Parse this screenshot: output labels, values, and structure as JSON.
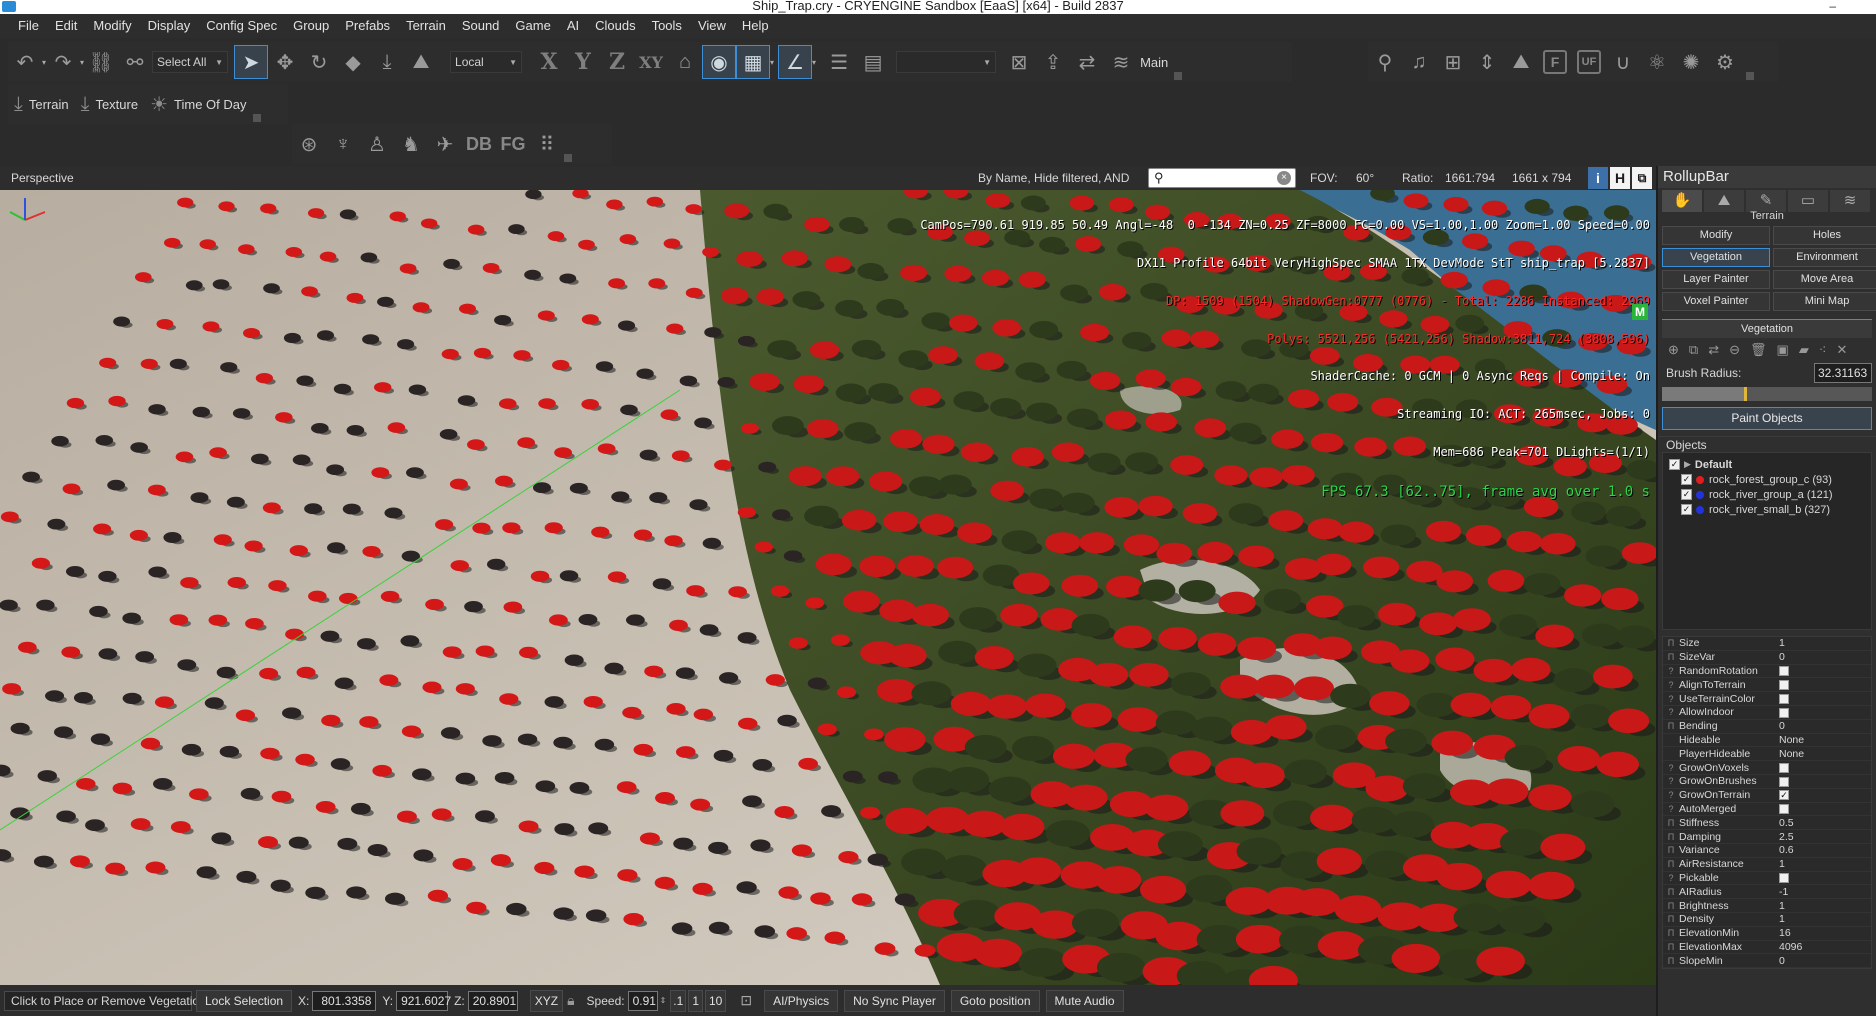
{
  "titlebar": {
    "title": "Ship_Trap.cry - CRYENGINE Sandbox [EaaS] [x64] - Build 2837"
  },
  "menu": [
    "File",
    "Edit",
    "Modify",
    "Display",
    "Config Spec",
    "Group",
    "Prefabs",
    "Terrain",
    "Sound",
    "Game",
    "AI",
    "Clouds",
    "Tools",
    "View",
    "Help"
  ],
  "toolbar": {
    "select_all": "Select All",
    "ref_coord": "Local",
    "axis_x": "X",
    "axis_y": "Y",
    "axis_z": "Z",
    "axis_xy": "XY",
    "layer_label": "Main",
    "letter_f": "F",
    "letter_uf": "UF",
    "terrain_label": "Terrain",
    "texture_label": "Texture",
    "tod_label": "Time Of Day",
    "db_label": "DB",
    "fg_label": "FG"
  },
  "viewport": {
    "title": "Perspective",
    "filter_text": "By Name, Hide filtered, AND",
    "search_value": "",
    "fov_label": "FOV:",
    "fov_value": "60°",
    "ratio_label": "Ratio:",
    "ratio_value": "1661:794",
    "resolution": "1661 x 794",
    "toggle_i": "i",
    "toggle_h": "H",
    "stats": [
      {
        "text": "CamPos=790.61 919.85 50.49 Angl=-48  0 -134 ZN=0.25 ZF=8000 FC=0.00 VS=1.00,1.00 Zoom=1.00 Speed=0.00",
        "color": "#ffffff"
      },
      {
        "text": "DX11 Profile 64bit VeryHighSpec SMAA 1TX DevMode StT ship_trap [5.2837]",
        "color": "#ffffff"
      },
      {
        "text": "DP: 1509 (1504) ShadowGen:0777 (0776) - Total: 2286 Instanced: 2969",
        "color": "#ff2a2a"
      },
      {
        "text": "Polys: 5521,256 (5421,256) Shadow:3811,724 (3808,596)",
        "color": "#ff2a2a"
      },
      {
        "text": "ShaderCache: 0 GCM | 0 Async Reqs | Compile: On",
        "color": "#ffffff"
      },
      {
        "text": "Streaming IO: ACT: 265msec, Jobs: 0",
        "color": "#ffffff"
      },
      {
        "text": "Mem=686 Peak=701 DLights=(1/1)",
        "color": "#ffffff"
      }
    ],
    "fps": "FPS 67.3 [62..75], frame avg over 1.0 s",
    "m_badge": "M"
  },
  "statusbar": {
    "hint": "Click to Place or Remove Vegetation",
    "lock_selection": "Lock Selection",
    "x_label": "X:",
    "x_value": "801.3358",
    "y_label": "Y:",
    "y_value": "921.6027",
    "z_label": "Z:",
    "z_value": "20.8901",
    "xyz_btn": "XYZ",
    "speed_label": "Speed:",
    "speed_value": "0.91",
    "speed_01": ".1",
    "speed_1": "1",
    "speed_10": "10",
    "ai_physics": "AI/Physics",
    "no_sync": "No Sync Player",
    "goto_position": "Goto position",
    "mute_audio": "Mute Audio"
  },
  "rollup": {
    "title": "RollupBar",
    "section_title": "Terrain",
    "buttons": [
      "Modify",
      "Holes",
      "Vegetation",
      "Environment",
      "Layer Painter",
      "Move Area",
      "Voxel Painter",
      "Mini Map"
    ],
    "vegetation_header": "Vegetation",
    "brush_radius_label": "Brush Radius:",
    "brush_radius_value": "32.31163",
    "brush_fraction": 0.39,
    "paint_objects": "Paint Objects",
    "objects_label": "Objects",
    "tree_group": "Default",
    "tree_items": [
      {
        "label": "rock_forest_group_c (93)",
        "color": "#e01e1e"
      },
      {
        "label": "rock_river_group_a (121)",
        "color": "#2233dd"
      },
      {
        "label": "rock_river_small_b (327)",
        "color": "#2233dd"
      }
    ],
    "properties": [
      {
        "icon": "Π",
        "name": "Size",
        "value": "1"
      },
      {
        "icon": "Π",
        "name": "SizeVar",
        "value": "0"
      },
      {
        "icon": "?",
        "name": "RandomRotation",
        "value": "",
        "check": false
      },
      {
        "icon": "?",
        "name": "AlignToTerrain",
        "value": "",
        "check": false
      },
      {
        "icon": "?",
        "name": "UseTerrainColor",
        "value": "",
        "check": false
      },
      {
        "icon": "?",
        "name": "AllowIndoor",
        "value": "",
        "check": false
      },
      {
        "icon": "Π",
        "name": "Bending",
        "value": "0"
      },
      {
        "icon": "",
        "name": "Hideable",
        "value": "None"
      },
      {
        "icon": "",
        "name": "PlayerHideable",
        "value": "None"
      },
      {
        "icon": "?",
        "name": "GrowOnVoxels",
        "value": "",
        "check": false
      },
      {
        "icon": "?",
        "name": "GrowOnBrushes",
        "value": "",
        "check": false
      },
      {
        "icon": "?",
        "name": "GrowOnTerrain",
        "value": "",
        "check": true
      },
      {
        "icon": "?",
        "name": "AutoMerged",
        "value": "",
        "check": false
      },
      {
        "icon": "Π",
        "name": "Stiffness",
        "value": "0.5"
      },
      {
        "icon": "Π",
        "name": "Damping",
        "value": "2.5"
      },
      {
        "icon": "Π",
        "name": "Variance",
        "value": "0.6"
      },
      {
        "icon": "Π",
        "name": "AirResistance",
        "value": "1"
      },
      {
        "icon": "?",
        "name": "Pickable",
        "value": "",
        "check": false
      },
      {
        "icon": "Π",
        "name": "AIRadius",
        "value": "-1"
      },
      {
        "icon": "Π",
        "name": "Brightness",
        "value": "1"
      },
      {
        "icon": "Π",
        "name": "Density",
        "value": "1"
      },
      {
        "icon": "Π",
        "name": "ElevationMin",
        "value": "16"
      },
      {
        "icon": "Π",
        "name": "ElevationMax",
        "value": "4096"
      },
      {
        "icon": "Π",
        "name": "SlopeMin",
        "value": "0"
      }
    ]
  },
  "colors": {
    "accent": "#3c8ed6",
    "sand": "#c9c0b4",
    "grass": "#3a4a22",
    "water": "#3a6f93",
    "rock_red": "#d41818"
  }
}
